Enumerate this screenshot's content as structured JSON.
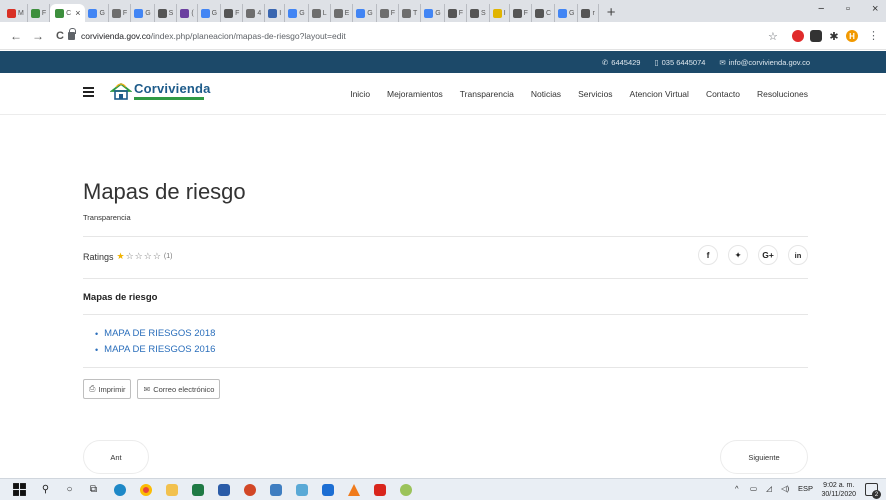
{
  "browser": {
    "tabs": [
      {
        "icon": "gmail-icon",
        "label": "M",
        "color": "#d93025"
      },
      {
        "icon": "site-icon",
        "label": "F",
        "color": "#3d8f3d"
      },
      {
        "icon": "site-icon",
        "label": "C",
        "color": "#3d8f3d",
        "active": true
      },
      {
        "icon": "google-icon",
        "label": "G",
        "color": "#4285f4"
      },
      {
        "icon": "shield-icon",
        "label": "F",
        "color": "#6e6e6e"
      },
      {
        "icon": "google-icon",
        "label": "G",
        "color": "#4285f4"
      },
      {
        "icon": "chrome-icon",
        "label": "S",
        "color": "#555555"
      },
      {
        "icon": "mail-icon",
        "label": "(",
        "color": "#6b3fa0"
      },
      {
        "icon": "google-icon",
        "label": "G",
        "color": "#4285f4"
      },
      {
        "icon": "chrome-icon",
        "label": "F",
        "color": "#555555"
      },
      {
        "icon": "shield-icon",
        "label": "4",
        "color": "#6e6e6e"
      },
      {
        "icon": "doc-icon",
        "label": "I",
        "color": "#3a66b0"
      },
      {
        "icon": "google-icon",
        "label": "G",
        "color": "#4285f4"
      },
      {
        "icon": "shield-icon",
        "label": "L",
        "color": "#6e6e6e"
      },
      {
        "icon": "shield-icon",
        "label": "E",
        "color": "#6e6e6e"
      },
      {
        "icon": "google-icon",
        "label": "G",
        "color": "#4285f4"
      },
      {
        "icon": "shield-icon",
        "label": "F",
        "color": "#6e6e6e"
      },
      {
        "icon": "shield-icon",
        "label": "T",
        "color": "#6e6e6e"
      },
      {
        "icon": "google-icon",
        "label": "G",
        "color": "#4285f4"
      },
      {
        "icon": "chrome-icon",
        "label": "F",
        "color": "#555555"
      },
      {
        "icon": "chrome-icon",
        "label": "S",
        "color": "#555555"
      },
      {
        "icon": "site-icon",
        "label": "I",
        "color": "#e0b400"
      },
      {
        "icon": "chrome-icon",
        "label": "F",
        "color": "#555555"
      },
      {
        "icon": "chrome-icon",
        "label": "C",
        "color": "#555555"
      },
      {
        "icon": "google-icon",
        "label": "G",
        "color": "#4285f4"
      },
      {
        "icon": "chrome-icon",
        "label": "r",
        "color": "#555555"
      }
    ],
    "active_tab_close": "×",
    "new_tab": "+",
    "minimize": "−",
    "restore": "▫",
    "close": "×",
    "back": "←",
    "forward": "→",
    "reload": "C",
    "url_host": "corvivienda.gov.co",
    "url_path": "/index.php/planeacion/mapas-de-riesgo?layout=edit",
    "bookmark": "☆",
    "profile_initial": "H",
    "menu": "⋮"
  },
  "topbar": {
    "phone1": "6445429",
    "phone2": "035 6445074",
    "email": "info@corvivienda.gov.co"
  },
  "site": {
    "logo_name": "Corvivienda",
    "nav": [
      "Inicio",
      "Mejoramientos",
      "Transparencia",
      "Noticias",
      "Servicios",
      "Atencion Virtual",
      "Contacto",
      "Resoluciones"
    ]
  },
  "article": {
    "title": "Mapas de riesgo",
    "category": "Transparencia",
    "ratings_label": "Ratings",
    "rating_value": 1,
    "rating_max": 5,
    "rating_count": "(1)",
    "section_heading": "Mapas de riesgo",
    "documents": [
      "MAPA DE RIESGOS 2018",
      "MAPA DE RIESGOS 2016"
    ],
    "print_label": "Imprimir",
    "email_label": "Correo electrónico",
    "prev_label": "Ant",
    "next_label": "Siguiente"
  },
  "social": {
    "facebook": "f",
    "twitter": "✦",
    "googleplus": "G+",
    "linkedin": "in"
  },
  "taskbar": {
    "language": "ESP",
    "time": "9:02 a. m.",
    "date": "30/11/2020",
    "notifications": "2"
  }
}
